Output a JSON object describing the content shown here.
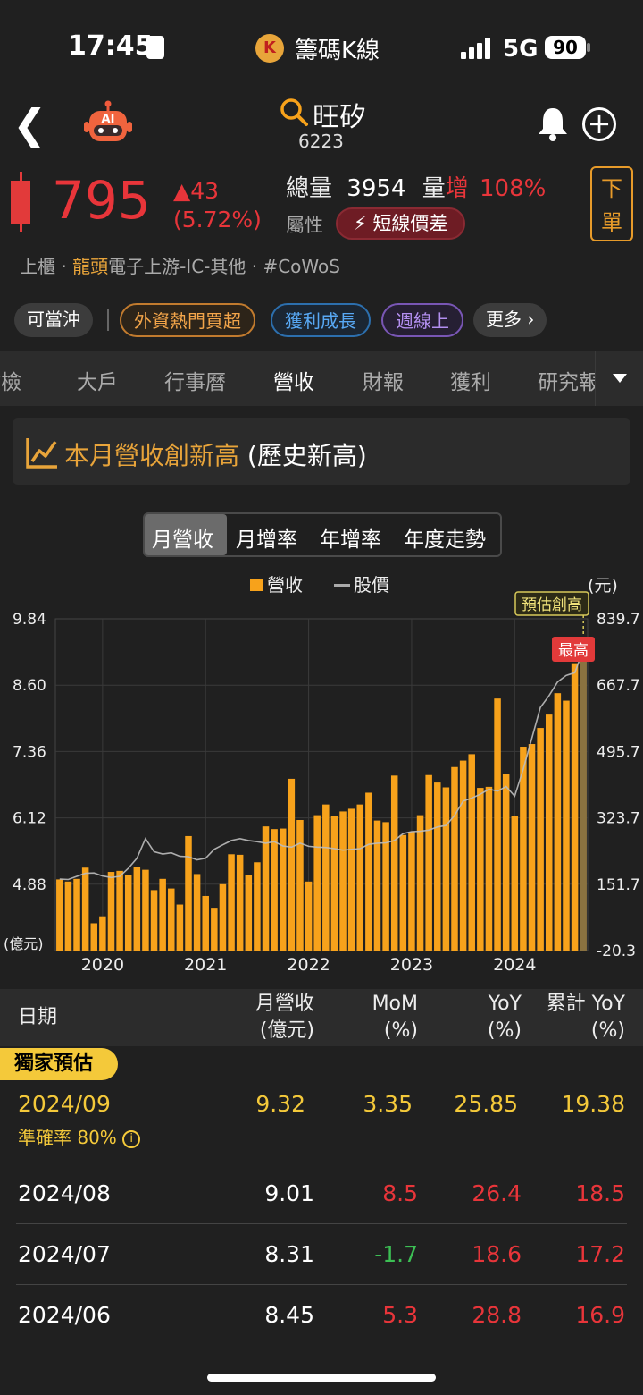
{
  "status_bar": {
    "time": "17:45",
    "app_name": "籌碼K線",
    "network": "5G",
    "battery": "90"
  },
  "header": {
    "stock_name": "旺矽",
    "stock_code": "6223"
  },
  "quote": {
    "price": "795",
    "change": "▲43",
    "change_pct": "(5.72%)",
    "volume_label": "總量",
    "volume_value": "3954",
    "volume_increase_label_a": "量",
    "volume_increase_label_b": "增",
    "volume_increase_value": "108%",
    "attr_label": "屬性",
    "attr_badge": "短線價差",
    "order_button": [
      "下",
      "單"
    ],
    "market": "上櫃",
    "industry_lead": "龍頭",
    "industry_rest": "電子上游-IC-其他 · #CoWoS"
  },
  "chips": [
    "可當沖",
    "外資熱門買超",
    "獲利成長",
    "週線上",
    "更多 ›"
  ],
  "tabs": [
    "健檢",
    "大戶",
    "行事曆",
    "營收",
    "財報",
    "獲利",
    "研究報"
  ],
  "banner": {
    "title": "本月營收創新高",
    "suffix": " (歷史新高)"
  },
  "segments": [
    "月營收",
    "月增率",
    "年增率",
    "年度走勢"
  ],
  "chart_data": {
    "type": "bar",
    "legend": [
      "營收",
      "股價"
    ],
    "y_left_ticks": [
      "9.84",
      "8.60",
      "7.36",
      "6.12",
      "4.88",
      "(億元)"
    ],
    "y_right_unit": "(元)",
    "y_right_ticks": [
      "839.7",
      "667.7",
      "495.7",
      "323.7",
      "151.7",
      "-20.3"
    ],
    "x_ticks": [
      "2020",
      "2021",
      "2022",
      "2023",
      "2024"
    ],
    "ylim_left": [
      3.64,
      9.84
    ],
    "ylim_right": [
      -20.3,
      839.7
    ],
    "annotations": {
      "forecast": "預估創高",
      "high": "最高"
    },
    "series": [
      {
        "name": "營收",
        "values": [
          4.97,
          4.93,
          4.98,
          5.19,
          4.15,
          4.28,
          5.11,
          5.13,
          5.06,
          5.21,
          5.15,
          4.77,
          4.98,
          4.8,
          4.5,
          5.78,
          5.07,
          4.66,
          4.44,
          4.88,
          5.44,
          5.43,
          5.06,
          5.29,
          5.96,
          5.91,
          5.92,
          6.85,
          6.08,
          4.93,
          6.17,
          6.37,
          6.15,
          6.24,
          6.29,
          6.37,
          6.59,
          6.07,
          6.04,
          6.91,
          5.8,
          5.86,
          6.17,
          6.92,
          6.78,
          6.69,
          7.07,
          7.19,
          7.31,
          6.68,
          6.7,
          8.35,
          6.94,
          6.16,
          7.45,
          7.5,
          7.8,
          8.05,
          8.45,
          8.31,
          9.01,
          9.32
        ]
      },
      {
        "name": "股價",
        "values": [
          165,
          164,
          172,
          180,
          181,
          173,
          169,
          172,
          193,
          219,
          270,
          236,
          230,
          233,
          224,
          223,
          215,
          219,
          242,
          254,
          265,
          270,
          265,
          262,
          258,
          262,
          251,
          248,
          258,
          250,
          248,
          247,
          244,
          240,
          242,
          244,
          255,
          258,
          259,
          265,
          283,
          288,
          289,
          292,
          300,
          304,
          330,
          367,
          375,
          385,
          398,
          393,
          405,
          380,
          450,
          530,
          610,
          640,
          676,
          693,
          700,
          760
        ]
      }
    ]
  },
  "table": {
    "headers": [
      {
        "top": "日期",
        "bottom": ""
      },
      {
        "top": "月營收",
        "bottom": "(億元)"
      },
      {
        "top": "MoM",
        "bottom": "(%)"
      },
      {
        "top": "YoY",
        "bottom": "(%)"
      },
      {
        "top": "累計 YoY",
        "bottom": "(%)"
      }
    ],
    "exclusive_label": "獨家預估",
    "forecast_row": {
      "date": "2024/09",
      "accuracy": "準確率 80%",
      "revenue": "9.32",
      "mom": "3.35",
      "yoy": "25.85",
      "cum_yoy": "19.38"
    },
    "rows": [
      {
        "date": "2024/08",
        "revenue": "9.01",
        "mom": "8.5",
        "yoy": "26.4",
        "cum_yoy": "18.5"
      },
      {
        "date": "2024/07",
        "revenue": "8.31",
        "mom": "-1.7",
        "yoy": "18.6",
        "cum_yoy": "17.2"
      },
      {
        "date": "2024/06",
        "revenue": "8.45",
        "mom": "5.3",
        "yoy": "28.8",
        "cum_yoy": "16.9"
      }
    ]
  },
  "colors": {
    "accent_orange": "#f7a21b",
    "price_red": "#e8353a",
    "down_green": "#3cbf54",
    "forecast_yellow": "#f4c93a"
  }
}
